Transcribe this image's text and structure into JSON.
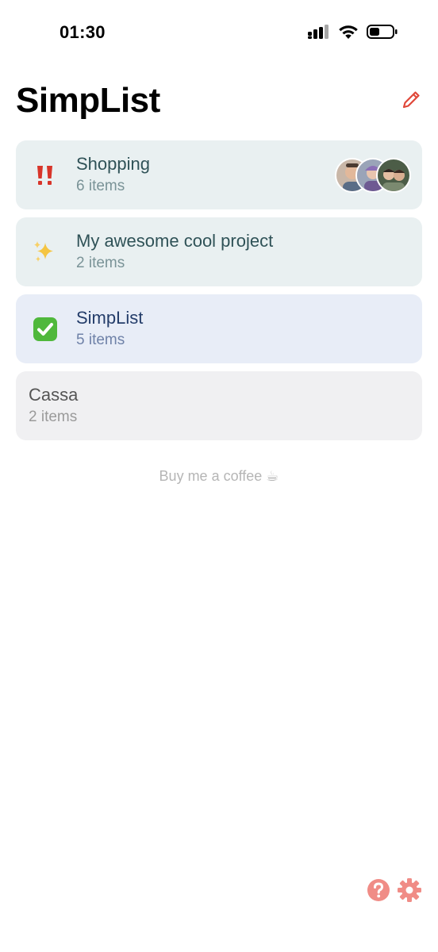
{
  "status_bar": {
    "time": "01:30",
    "icons": [
      "cellular-signal-icon",
      "wifi-icon",
      "battery-icon"
    ]
  },
  "header": {
    "title": "SimpList",
    "edit_icon": "pencil-icon",
    "accent_color": "#e0483a"
  },
  "lists": [
    {
      "name": "Shopping",
      "subtitle": "6 items",
      "icon": "double-exclamation-icon",
      "shared_with_avatars": 3
    },
    {
      "name": "My awesome cool project",
      "subtitle": "2 items",
      "icon": "sparkles-icon"
    },
    {
      "name": "SimpList",
      "subtitle": "5 items",
      "icon": "check-mark-icon"
    },
    {
      "name": "Cassa",
      "subtitle": "2 items"
    }
  ],
  "footer": {
    "coffee_text": "Buy me a coffee ☕"
  },
  "bottom_bar": {
    "icons": [
      "help-icon",
      "gear-icon"
    ],
    "icon_color": "#f08c86"
  }
}
